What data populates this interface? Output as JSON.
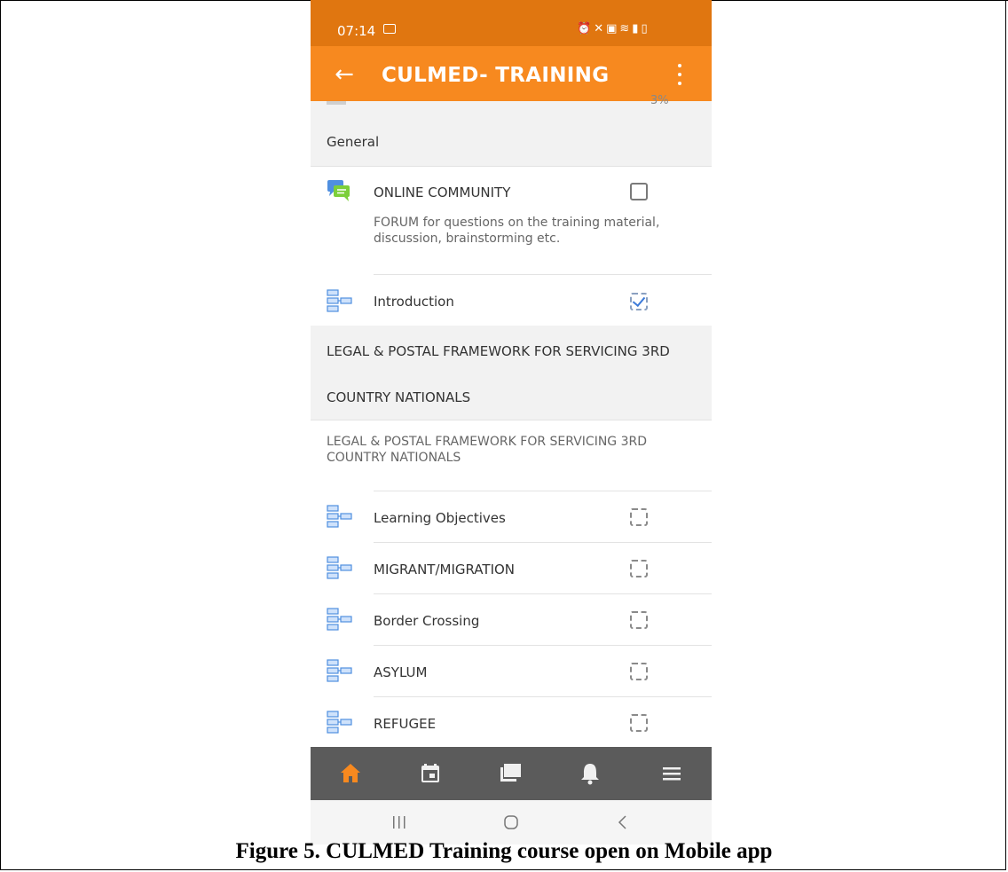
{
  "status_bar": {
    "time": "07:14",
    "icons": [
      "alarm-icon",
      "mute-icon",
      "lock-icon",
      "wifi-icon",
      "signal-icon",
      "battery-icon"
    ]
  },
  "app_bar": {
    "title": "CULMED- TRAINING",
    "back_icon": "arrow-left-icon",
    "menu_icon": "more-vertical-icon"
  },
  "progress": {
    "percent": 3,
    "label": "3%"
  },
  "sections": [
    {
      "title": "General",
      "items": [
        {
          "type": "forum",
          "icon": "forum-icon",
          "label": "ONLINE COMMUNITY",
          "description": "FORUM for questions on the training material, discussion, brainstorming etc.",
          "completion": "manual-incomplete"
        },
        {
          "type": "book",
          "icon": "book-icon",
          "label": "Introduction",
          "completion": "auto-complete"
        }
      ]
    },
    {
      "title_line1": "LEGAL & POSTAL FRAMEWORK FOR SERVICING 3RD",
      "title_line2": "COUNTRY NATIONALS",
      "summary": "LEGAL & POSTAL FRAMEWORK FOR SERVICING 3RD COUNTRY NATIONALS",
      "items": [
        {
          "type": "book",
          "icon": "book-icon",
          "label": "Learning Objectives",
          "completion": "auto-incomplete"
        },
        {
          "type": "book",
          "icon": "book-icon",
          "label": "MIGRANT/MIGRATION",
          "completion": "auto-incomplete"
        },
        {
          "type": "book",
          "icon": "book-icon",
          "label": "Border Crossing",
          "completion": "auto-incomplete"
        },
        {
          "type": "book",
          "icon": "book-icon",
          "label": "ASYLUM",
          "completion": "auto-incomplete"
        },
        {
          "type": "book",
          "icon": "book-icon",
          "label": "REFUGEE",
          "completion": "auto-incomplete"
        }
      ]
    }
  ],
  "bottom_nav": [
    {
      "icon": "home-icon",
      "active": true
    },
    {
      "icon": "calendar-icon",
      "active": false
    },
    {
      "icon": "messages-icon",
      "active": false
    },
    {
      "icon": "bell-icon",
      "active": false
    },
    {
      "icon": "menu-icon",
      "active": false
    }
  ],
  "system_nav": [
    "recent-apps-icon",
    "home-circle-icon",
    "back-chevron-icon"
  ],
  "caption": "Figure 5. CULMED Training course open on Mobile app",
  "colors": {
    "status_bar": "#e07610",
    "app_bar": "#f7891f",
    "nav_active": "#f7891f",
    "bottom_nav_bg": "#5b5b5b",
    "check_blue": "#3d7bd9"
  }
}
